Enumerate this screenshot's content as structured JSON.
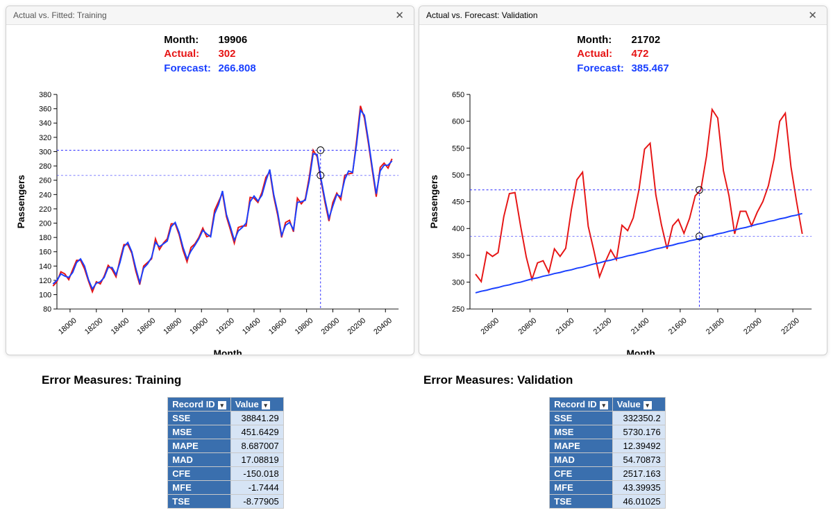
{
  "panels": {
    "training": {
      "title": "Actual vs. Fitted: Training",
      "hover": {
        "month_label": "Month:",
        "month": "19906",
        "actual_label": "Actual:",
        "actual": "302",
        "forecast_label": "Forecast:",
        "forecast": "266.808"
      }
    },
    "validation": {
      "title": "Actual vs. Forecast: Validation",
      "hover": {
        "month_label": "Month:",
        "month": "21702",
        "actual_label": "Actual:",
        "actual": "472",
        "forecast_label": "Forecast:",
        "forecast": "385.467"
      }
    }
  },
  "error_titles": {
    "training": "Error Measures: Training",
    "validation": "Error Measures: Validation"
  },
  "table_headers": {
    "record_id": "Record ID",
    "value": "Value"
  },
  "errors_training": [
    {
      "id": "SSE",
      "val": "38841.29"
    },
    {
      "id": "MSE",
      "val": "451.6429"
    },
    {
      "id": "MAPE",
      "val": "8.687007"
    },
    {
      "id": "MAD",
      "val": "17.08819"
    },
    {
      "id": "CFE",
      "val": "-150.018"
    },
    {
      "id": "MFE",
      "val": "-1.7444"
    },
    {
      "id": "TSE",
      "val": "-8.77905"
    }
  ],
  "errors_validation": [
    {
      "id": "SSE",
      "val": "332350.2"
    },
    {
      "id": "MSE",
      "val": "5730.176"
    },
    {
      "id": "MAPE",
      "val": "12.39492"
    },
    {
      "id": "MAD",
      "val": "54.70873"
    },
    {
      "id": "CFE",
      "val": "2517.163"
    },
    {
      "id": "MFE",
      "val": "43.39935"
    },
    {
      "id": "TSE",
      "val": "46.01025"
    }
  ],
  "colors": {
    "actual": "#e61515",
    "forecast": "#1a40ff",
    "guides": "#2b2bff"
  },
  "chart_data": [
    {
      "id": "training",
      "type": "line",
      "xlabel": "Month",
      "ylabel": "Passengers",
      "xlim": [
        17900,
        20500
      ],
      "ylim": [
        80,
        380
      ],
      "x": [
        17870,
        17900,
        17930,
        17960,
        17990,
        18020,
        18050,
        18080,
        18110,
        18140,
        18170,
        18200,
        18230,
        18260,
        18290,
        18320,
        18350,
        18380,
        18410,
        18440,
        18470,
        18500,
        18530,
        18560,
        18590,
        18620,
        18650,
        18680,
        18710,
        18740,
        18770,
        18800,
        18830,
        18860,
        18890,
        18920,
        18950,
        18980,
        19010,
        19040,
        19070,
        19100,
        19130,
        19160,
        19190,
        19220,
        19250,
        19280,
        19310,
        19340,
        19370,
        19400,
        19430,
        19460,
        19490,
        19520,
        19550,
        19580,
        19610,
        19640,
        19670,
        19700,
        19730,
        19760,
        19790,
        19820,
        19850,
        19880,
        19910,
        19940,
        19970,
        20000,
        20030,
        20060,
        20090,
        20120,
        20150,
        20180,
        20210,
        20240,
        20270,
        20300,
        20330,
        20360,
        20390,
        20420,
        20450
      ],
      "series": [
        {
          "name": "Actual",
          "color": "#e61515",
          "values": [
            112,
            118,
            132,
            129,
            121,
            135,
            148,
            148,
            136,
            119,
            104,
            118,
            115,
            126,
            141,
            135,
            125,
            149,
            170,
            170,
            158,
            133,
            114,
            140,
            145,
            150,
            178,
            163,
            172,
            178,
            199,
            199,
            184,
            162,
            146,
            166,
            171,
            180,
            193,
            181,
            183,
            218,
            230,
            242,
            209,
            191,
            172,
            194,
            196,
            196,
            236,
            235,
            229,
            243,
            264,
            272,
            237,
            211,
            180,
            201,
            204,
            188,
            235,
            227,
            234,
            264,
            302,
            293,
            259,
            229,
            203,
            229,
            242,
            233,
            267,
            269,
            270,
            315,
            364,
            347,
            312,
            274,
            237,
            278,
            284,
            277,
            290
          ]
        },
        {
          "name": "Forecast",
          "color": "#1a40ff",
          "values": [
            115,
            120,
            129,
            126,
            124,
            131,
            145,
            150,
            140,
            121,
            108,
            116,
            118,
            124,
            138,
            138,
            128,
            145,
            167,
            173,
            160,
            137,
            117,
            137,
            143,
            152,
            173,
            167,
            171,
            175,
            195,
            201,
            187,
            166,
            150,
            161,
            169,
            178,
            190,
            185,
            181,
            213,
            226,
            245,
            212,
            195,
            176,
            189,
            194,
            200,
            230,
            238,
            231,
            239,
            259,
            275,
            240,
            215,
            183,
            197,
            201,
            191,
            229,
            230,
            232,
            259,
            297,
            296,
            262,
            233,
            207,
            224,
            240,
            237,
            261,
            273,
            271,
            310,
            358,
            351,
            316,
            278,
            241,
            273,
            281,
            281,
            287
          ]
        }
      ],
      "hover_point": {
        "x": 19906,
        "actual": 302,
        "forecast": 266.808
      }
    },
    {
      "id": "validation",
      "type": "line",
      "xlabel": "Month",
      "ylabel": "Passengers",
      "xlim": [
        20480,
        22300
      ],
      "ylim": [
        250,
        650
      ],
      "x": [
        20510,
        20540,
        20570,
        20600,
        20630,
        20660,
        20690,
        20720,
        20750,
        20780,
        20810,
        20840,
        20870,
        20900,
        20930,
        20960,
        20990,
        21020,
        21050,
        21080,
        21110,
        21140,
        21170,
        21200,
        21230,
        21260,
        21290,
        21320,
        21350,
        21380,
        21410,
        21440,
        21470,
        21500,
        21530,
        21560,
        21590,
        21620,
        21650,
        21680,
        21710,
        21740,
        21770,
        21800,
        21830,
        21860,
        21890,
        21920,
        21950,
        21980,
        22010,
        22040,
        22070,
        22100,
        22130,
        22160,
        22190,
        22220,
        22250
      ],
      "series": [
        {
          "name": "Actual",
          "color": "#e61515",
          "values": [
            315,
            301,
            356,
            348,
            355,
            422,
            465,
            467,
            404,
            347,
            305,
            336,
            340,
            318,
            362,
            348,
            363,
            435,
            491,
            505,
            404,
            359,
            310,
            337,
            360,
            342,
            406,
            396,
            420,
            472,
            548,
            559,
            463,
            407,
            362,
            405,
            417,
            391,
            419,
            461,
            472,
            535,
            622,
            606,
            508,
            461,
            390,
            432,
            432,
            405,
            430,
            450,
            480,
            530,
            600,
            615,
            515,
            450,
            390
          ]
        },
        {
          "name": "Forecast",
          "color": "#1a40ff",
          "values": [
            280,
            283,
            285,
            288,
            290,
            293,
            295,
            298,
            300,
            303,
            306,
            308,
            311,
            313,
            316,
            318,
            321,
            323,
            326,
            328,
            331,
            334,
            336,
            339,
            341,
            344,
            346,
            349,
            351,
            354,
            356,
            359,
            362,
            364,
            367,
            369,
            372,
            374,
            377,
            379,
            382,
            385,
            387,
            390,
            392,
            395,
            397,
            400,
            402,
            405,
            408,
            410,
            413,
            415,
            418,
            420,
            423,
            425,
            428
          ]
        }
      ],
      "hover_point": {
        "x": 21702,
        "actual": 472,
        "forecast": 385.467
      }
    }
  ]
}
